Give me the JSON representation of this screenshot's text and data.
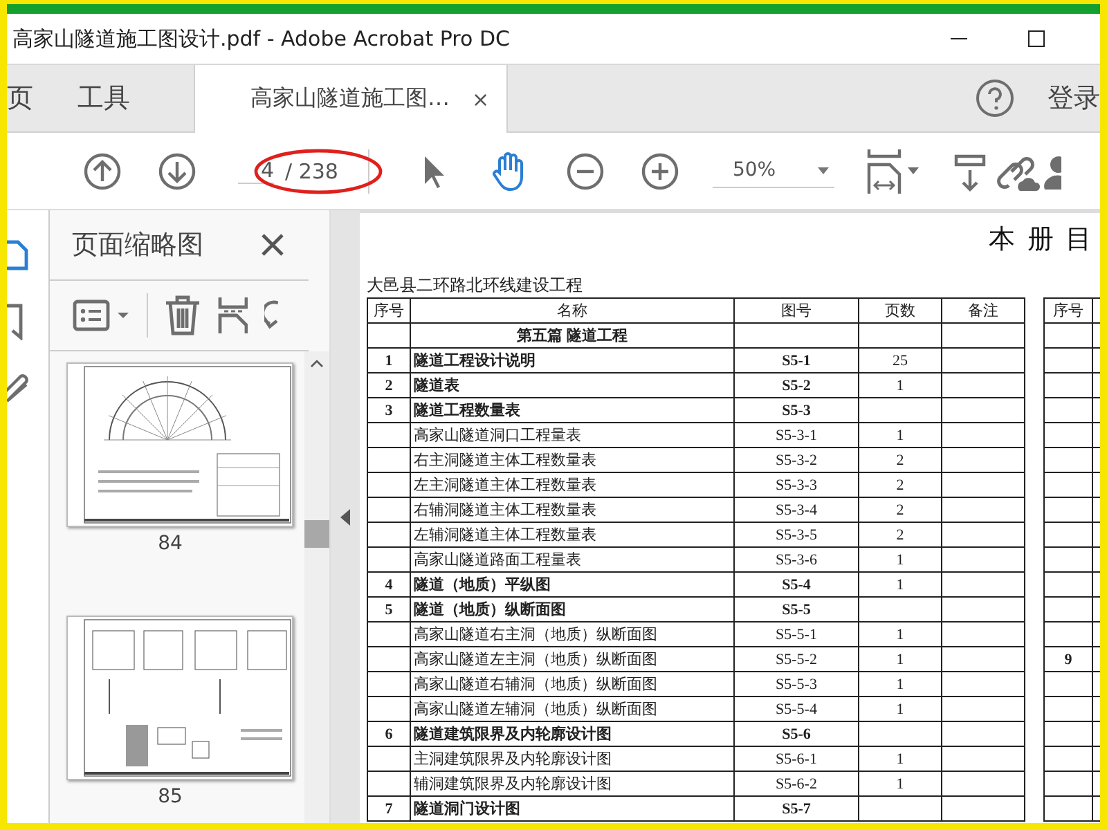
{
  "window": {
    "title": "高家山隧道施工图设计.pdf - Adobe Acrobat Pro DC"
  },
  "tabs": [
    {
      "label": "页",
      "selected": false
    },
    {
      "label": "工具",
      "selected": false
    },
    {
      "label": "高家山隧道施工图…",
      "selected": true,
      "close": "×"
    }
  ],
  "account": {
    "label": "登录"
  },
  "toolbar": {
    "page_input": "4",
    "page_total": "/ 238",
    "zoom": "50%",
    "tools": [
      {
        "kind": "pointer",
        "selected": false
      },
      {
        "kind": "hand",
        "selected": true
      }
    ]
  },
  "rail": [
    {
      "kind": "pages",
      "selected": true
    },
    {
      "kind": "bookmark",
      "selected": false
    },
    {
      "kind": "attachment",
      "selected": false
    }
  ],
  "panel": {
    "title": "页面缩略图",
    "thumbnails": [
      {
        "label": "84",
        "kind": "arch"
      },
      {
        "label": "85",
        "kind": "detail"
      }
    ]
  },
  "document": {
    "heading": "本 册 目",
    "project": "大邑县二环路北环线建设工程",
    "table": {
      "columns": [
        "序号",
        "名称",
        "图号",
        "页数",
        "备注",
        "序号"
      ],
      "rows": [
        {
          "kind": "part",
          "name": "第五篇  隧道工程"
        },
        {
          "kind": "main",
          "no": "1",
          "name": "隧道工程设计说明",
          "figure": "S5-1",
          "pages": "25"
        },
        {
          "kind": "main",
          "no": "2",
          "name": "隧道表",
          "figure": "S5-2",
          "pages": "1"
        },
        {
          "kind": "main",
          "no": "3",
          "name": "隧道工程数量表",
          "figure": "S5-3"
        },
        {
          "kind": "sub",
          "name": "高家山隧道洞口工程量表",
          "figure": "S5-3-1",
          "pages": "1"
        },
        {
          "kind": "sub",
          "name": "右主洞隧道主体工程数量表",
          "figure": "S5-3-2",
          "pages": "2"
        },
        {
          "kind": "sub",
          "name": "左主洞隧道主体工程数量表",
          "figure": "S5-3-3",
          "pages": "2"
        },
        {
          "kind": "sub",
          "name": "右辅洞隧道主体工程数量表",
          "figure": "S5-3-4",
          "pages": "2"
        },
        {
          "kind": "sub",
          "name": "左辅洞隧道主体工程数量表",
          "figure": "S5-3-5",
          "pages": "2"
        },
        {
          "kind": "sub",
          "name": "高家山隧道路面工程量表",
          "figure": "S5-3-6",
          "pages": "1"
        },
        {
          "kind": "main",
          "no": "4",
          "name": "隧道（地质）平纵图",
          "figure": "S5-4",
          "pages": "1"
        },
        {
          "kind": "main",
          "no": "5",
          "name": "隧道（地质）纵断面图",
          "figure": "S5-5"
        },
        {
          "kind": "sub",
          "name": "高家山隧道右主洞（地质）纵断面图",
          "figure": "S5-5-1",
          "pages": "1"
        },
        {
          "kind": "sub",
          "name": "高家山隧道左主洞（地质）纵断面图",
          "figure": "S5-5-2",
          "pages": "1",
          "no_2": "9"
        },
        {
          "kind": "sub",
          "name": "高家山隧道右辅洞（地质）纵断面图",
          "figure": "S5-5-3",
          "pages": "1"
        },
        {
          "kind": "sub",
          "name": "高家山隧道左辅洞（地质）纵断面图",
          "figure": "S5-5-4",
          "pages": "1"
        },
        {
          "kind": "main",
          "no": "6",
          "name": "隧道建筑限界及内轮廓设计图",
          "figure": "S5-6"
        },
        {
          "kind": "sub",
          "name": "主洞建筑限界及内轮廓设计图",
          "figure": "S5-6-1",
          "pages": "1"
        },
        {
          "kind": "sub",
          "name": "辅洞建筑限界及内轮廓设计图",
          "figure": "S5-6-2",
          "pages": "1"
        },
        {
          "kind": "main",
          "no": "7",
          "name": "隧道洞门设计图",
          "figure": "S5-7"
        }
      ]
    }
  }
}
